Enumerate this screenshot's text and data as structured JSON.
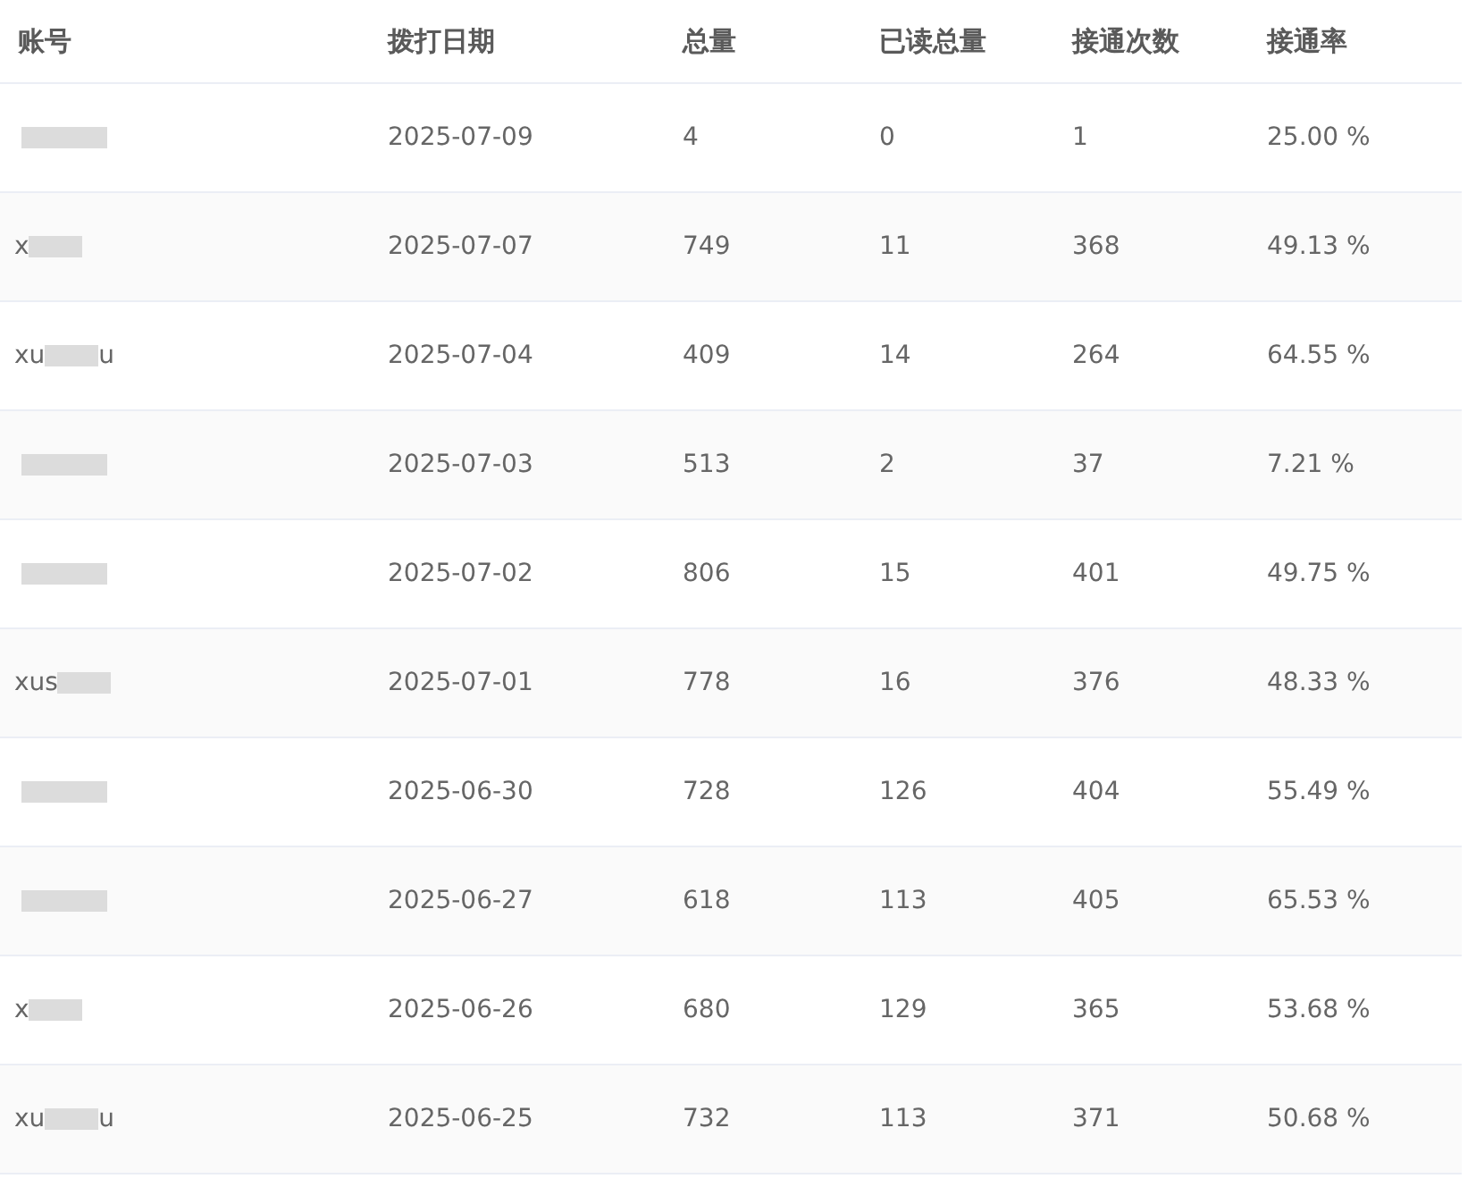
{
  "table": {
    "columns": [
      "账号",
      "拨打日期",
      "总量",
      "已读总量",
      "接通次数",
      "接通率"
    ],
    "rows": [
      {
        "account": "",
        "account_suffix": "",
        "date": "2025-07-09",
        "total": "4",
        "read_total": "0",
        "connected": "1",
        "rate": "25.00 %"
      },
      {
        "account": "x",
        "account_suffix": "",
        "date": "2025-07-07",
        "total": "749",
        "read_total": "11",
        "connected": "368",
        "rate": "49.13 %"
      },
      {
        "account": "xu",
        "account_suffix": "u",
        "date": "2025-07-04",
        "total": "409",
        "read_total": "14",
        "connected": "264",
        "rate": "64.55 %"
      },
      {
        "account": "",
        "account_suffix": "",
        "date": "2025-07-03",
        "total": "513",
        "read_total": "2",
        "connected": "37",
        "rate": "7.21 %"
      },
      {
        "account": "",
        "account_suffix": "",
        "date": "2025-07-02",
        "total": "806",
        "read_total": "15",
        "connected": "401",
        "rate": "49.75 %"
      },
      {
        "account": "xus",
        "account_suffix": "",
        "date": "2025-07-01",
        "total": "778",
        "read_total": "16",
        "connected": "376",
        "rate": "48.33 %"
      },
      {
        "account": "",
        "account_suffix": "",
        "date": "2025-06-30",
        "total": "728",
        "read_total": "126",
        "connected": "404",
        "rate": "55.49 %"
      },
      {
        "account": "",
        "account_suffix": "",
        "date": "2025-06-27",
        "total": "618",
        "read_total": "113",
        "connected": "405",
        "rate": "65.53 %"
      },
      {
        "account": "x",
        "account_suffix": "",
        "date": "2025-06-26",
        "total": "680",
        "read_total": "129",
        "connected": "365",
        "rate": "53.68 %"
      },
      {
        "account": "xu",
        "account_suffix": "u",
        "date": "2025-06-25",
        "total": "732",
        "read_total": "113",
        "connected": "371",
        "rate": "50.68 %"
      }
    ]
  }
}
